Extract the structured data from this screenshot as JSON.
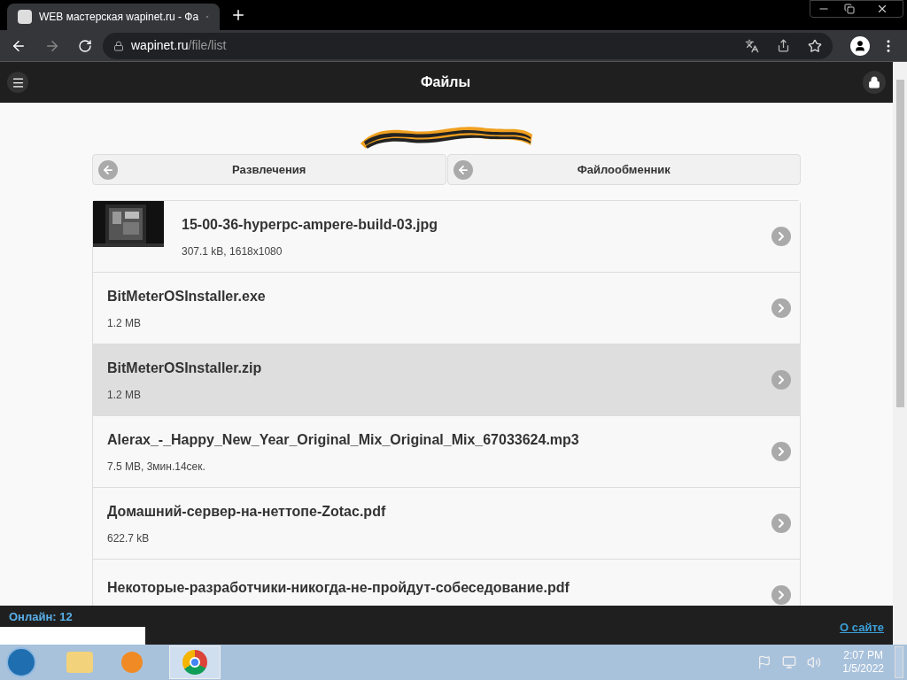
{
  "browser": {
    "tab_title": "WEB мастерская wapinet.ru - Фа",
    "url_host": "wapinet.ru",
    "url_path": "/file/list"
  },
  "header": {
    "title": "Файлы"
  },
  "nav": [
    {
      "label": "Развлечения"
    },
    {
      "label": "Файлообменник"
    }
  ],
  "files": [
    {
      "name": "15-00-36-hyperpc-ampere-build-03.jpg",
      "info": "307.1 kB, 1618x1080",
      "highlighted": false
    },
    {
      "kind": "file",
      "name": "BitMeterOSInstaller.exe",
      "info": "1.2 MB",
      "highlighted": false
    },
    {
      "kind": "file",
      "name": "BitMeterOSInstaller.zip",
      "info": "1.2 MB",
      "highlighted": true
    },
    {
      "kind": "file",
      "name": "Alerax_-_Happy_New_Year_Original_Mix_Original_Mix_67033624.mp3",
      "info": "7.5 MB, 3мин.14сек.",
      "highlighted": false
    },
    {
      "kind": "file",
      "name": "Домашний-сервер-на-неттопе-Zotac.pdf",
      "info": "622.7 kB",
      "highlighted": false
    },
    {
      "kind": "file",
      "name": "Некоторые-разработчики-никогда-не-пройдут-собеседование.pdf",
      "highlighted": false
    }
  ],
  "footer": {
    "online": "Онлайн: 12",
    "about": "О сайте"
  },
  "taskbar": {
    "time": "2:07 PM",
    "date": "1/5/2022"
  }
}
